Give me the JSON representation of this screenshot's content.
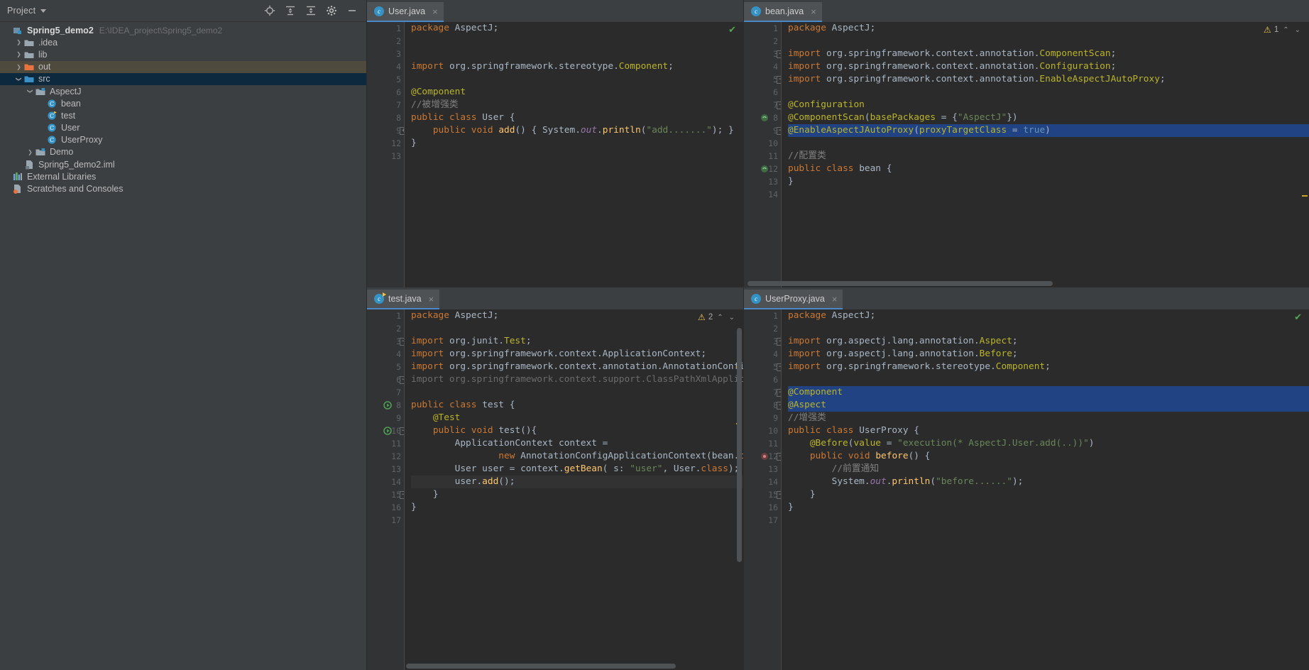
{
  "sidebar": {
    "title": "Project",
    "tools": [
      {
        "name": "locate-icon",
        "label": "Select Opened File"
      },
      {
        "name": "collapse-all-icon",
        "label": "Collapse All"
      },
      {
        "name": "expand-all-icon",
        "label": "Expand All"
      },
      {
        "name": "settings-gear-icon",
        "label": "Settings"
      },
      {
        "name": "hide-icon",
        "label": "Hide"
      }
    ],
    "tree": [
      {
        "label": "Spring5_demo2",
        "path": "E:\\IDEA_project\\Spring5_demo2",
        "icon": "module-icon",
        "indent": 0,
        "arrow": "",
        "bold": true,
        "state": "normal"
      },
      {
        "label": ".idea",
        "path": "",
        "icon": "folder-icon",
        "indent": 1,
        "arrow": "collapsed",
        "bold": false,
        "state": "normal"
      },
      {
        "label": "lib",
        "path": "",
        "icon": "folder-icon",
        "indent": 1,
        "arrow": "collapsed",
        "bold": false,
        "state": "normal"
      },
      {
        "label": "out",
        "path": "",
        "icon": "folder-orange-icon",
        "indent": 1,
        "arrow": "collapsed",
        "bold": false,
        "state": "out"
      },
      {
        "label": "src",
        "path": "",
        "icon": "folder-source-icon",
        "indent": 1,
        "arrow": "expanded",
        "bold": false,
        "state": "selected"
      },
      {
        "label": "AspectJ",
        "path": "",
        "icon": "package-icon",
        "indent": 2,
        "arrow": "expanded",
        "bold": false,
        "state": "normal"
      },
      {
        "label": "bean",
        "path": "",
        "icon": "java-class-icon",
        "indent": 3,
        "arrow": "",
        "bold": false,
        "state": "normal"
      },
      {
        "label": "test",
        "path": "",
        "icon": "java-test-class-icon",
        "indent": 3,
        "arrow": "",
        "bold": false,
        "state": "normal"
      },
      {
        "label": "User",
        "path": "",
        "icon": "java-class-icon",
        "indent": 3,
        "arrow": "",
        "bold": false,
        "state": "normal"
      },
      {
        "label": "UserProxy",
        "path": "",
        "icon": "java-class-icon",
        "indent": 3,
        "arrow": "",
        "bold": false,
        "state": "normal"
      },
      {
        "label": "Demo",
        "path": "",
        "icon": "package-icon",
        "indent": 2,
        "arrow": "collapsed",
        "bold": false,
        "state": "normal"
      },
      {
        "label": "Spring5_demo2.iml",
        "path": "",
        "icon": "iml-file-icon",
        "indent": 1,
        "arrow": "",
        "bold": false,
        "state": "normal"
      },
      {
        "label": "External Libraries",
        "path": "",
        "icon": "libraries-icon",
        "indent": 0,
        "arrow": "",
        "bold": false,
        "state": "normal"
      },
      {
        "label": "Scratches and Consoles",
        "path": "",
        "icon": "scratches-icon",
        "indent": 0,
        "arrow": "",
        "bold": false,
        "state": "normal"
      }
    ]
  },
  "panes": {
    "user": {
      "tab": {
        "label": "User.java",
        "icon": "java-class-icon",
        "close": "×"
      },
      "status": {
        "type": "ok",
        "icon": "check-icon",
        "count": ""
      },
      "lines": [
        {
          "n": "1",
          "mark": "",
          "fold": "",
          "sel": false
        },
        {
          "n": "2",
          "mark": "",
          "fold": "",
          "sel": false
        },
        {
          "n": "3",
          "mark": "",
          "fold": "",
          "sel": false
        },
        {
          "n": "4",
          "mark": "",
          "fold": "",
          "sel": false
        },
        {
          "n": "5",
          "mark": "",
          "fold": "",
          "sel": false
        },
        {
          "n": "6",
          "mark": "",
          "fold": "",
          "sel": false
        },
        {
          "n": "7",
          "mark": "",
          "fold": "",
          "sel": false
        },
        {
          "n": "8",
          "mark": "",
          "fold": "",
          "sel": false
        },
        {
          "n": "9",
          "mark": "",
          "fold": "plus",
          "sel": false
        },
        {
          "n": "12",
          "mark": "",
          "fold": "",
          "sel": false
        },
        {
          "n": "13",
          "mark": "",
          "fold": "",
          "sel": false
        }
      ],
      "code": [
        "package AspectJ;",
        "",
        "",
        "import org.springframework.stereotype.Component;",
        "",
        "@Component",
        "//被增强类",
        "public class User {",
        "    public void add() { System.out.println(\"add.......\"); }",
        "}",
        ""
      ]
    },
    "bean": {
      "tab": {
        "label": "bean.java",
        "icon": "java-class-icon",
        "close": "×"
      },
      "status": {
        "type": "warn",
        "icon": "warning-icon",
        "count": "1",
        "up": "⌃",
        "down": "⌄"
      },
      "lines": [
        {
          "n": "1",
          "mark": "",
          "fold": "",
          "sel": false
        },
        {
          "n": "2",
          "mark": "",
          "fold": "",
          "sel": false
        },
        {
          "n": "3",
          "mark": "",
          "fold": "minus",
          "sel": false
        },
        {
          "n": "4",
          "mark": "",
          "fold": "",
          "sel": false
        },
        {
          "n": "5",
          "mark": "",
          "fold": "minus",
          "sel": false
        },
        {
          "n": "6",
          "mark": "",
          "fold": "",
          "sel": false
        },
        {
          "n": "7",
          "mark": "",
          "fold": "minus",
          "sel": false
        },
        {
          "n": "8",
          "mark": "bean-gutter-icon",
          "fold": "",
          "sel": false
        },
        {
          "n": "9",
          "mark": "",
          "fold": "minus",
          "sel": true
        },
        {
          "n": "10",
          "mark": "",
          "fold": "",
          "sel": false
        },
        {
          "n": "11",
          "mark": "",
          "fold": "",
          "sel": false
        },
        {
          "n": "12",
          "mark": "bean-gutter-icon",
          "fold": "",
          "sel": false
        },
        {
          "n": "13",
          "mark": "",
          "fold": "",
          "sel": false
        },
        {
          "n": "14",
          "mark": "",
          "fold": "",
          "sel": false
        }
      ],
      "code": [
        "package AspectJ;",
        "",
        "import org.springframework.context.annotation.ComponentScan;",
        "import org.springframework.context.annotation.Configuration;",
        "import org.springframework.context.annotation.EnableAspectJAutoProxy;",
        "",
        "@Configuration",
        "@ComponentScan(basePackages = {\"AspectJ\"})",
        "@EnableAspectJAutoProxy(proxyTargetClass = true)",
        "",
        "//配置类",
        "public class bean {",
        "}",
        ""
      ]
    },
    "test": {
      "tab": {
        "label": "test.java",
        "icon": "java-test-class-icon",
        "close": "×"
      },
      "status": {
        "type": "warn",
        "icon": "warning-icon",
        "count": "2",
        "up": "⌃",
        "down": "⌄"
      },
      "lines": [
        {
          "n": "1",
          "mark": "",
          "fold": "",
          "sel": false
        },
        {
          "n": "2",
          "mark": "",
          "fold": "",
          "sel": false
        },
        {
          "n": "3",
          "mark": "",
          "fold": "minus",
          "sel": false
        },
        {
          "n": "4",
          "mark": "",
          "fold": "",
          "sel": false
        },
        {
          "n": "5",
          "mark": "",
          "fold": "",
          "sel": false
        },
        {
          "n": "6",
          "mark": "",
          "fold": "minus",
          "sel": false
        },
        {
          "n": "7",
          "mark": "",
          "fold": "",
          "sel": false
        },
        {
          "n": "8",
          "mark": "run-icon",
          "fold": "",
          "sel": false
        },
        {
          "n": "9",
          "mark": "",
          "fold": "",
          "sel": false
        },
        {
          "n": "10",
          "mark": "run-icon",
          "fold": "minus",
          "sel": false
        },
        {
          "n": "11",
          "mark": "",
          "fold": "",
          "sel": false
        },
        {
          "n": "12",
          "mark": "",
          "fold": "",
          "sel": false
        },
        {
          "n": "13",
          "mark": "",
          "fold": "",
          "sel": false
        },
        {
          "n": "14",
          "mark": "",
          "fold": "",
          "sel": false
        },
        {
          "n": "15",
          "mark": "",
          "fold": "minus",
          "sel": false
        },
        {
          "n": "16",
          "mark": "",
          "fold": "",
          "sel": false
        },
        {
          "n": "17",
          "mark": "",
          "fold": "",
          "sel": false
        }
      ],
      "code": [
        "package AspectJ;",
        "",
        "import org.junit.Test;",
        "import org.springframework.context.ApplicationContext;",
        "import org.springframework.context.annotation.AnnotationConfigApplicat",
        "import org.springframework.context.support.ClassPathXmlApplicationCon",
        "",
        "public class test {",
        "    @Test",
        "    public void test(){",
        "        ApplicationContext context =",
        "                new AnnotationConfigApplicationContext(bean.class);",
        "        User user = context.getBean( s: \"user\", User.class);",
        "        user.add();",
        "    }",
        "}",
        ""
      ]
    },
    "userproxy": {
      "tab": {
        "label": "UserProxy.java",
        "icon": "java-class-icon",
        "close": "×"
      },
      "status": {
        "type": "ok",
        "icon": "check-icon",
        "count": ""
      },
      "lines": [
        {
          "n": "1",
          "mark": "",
          "fold": "",
          "sel": false
        },
        {
          "n": "2",
          "mark": "",
          "fold": "",
          "sel": false
        },
        {
          "n": "3",
          "mark": "",
          "fold": "minus",
          "sel": false
        },
        {
          "n": "4",
          "mark": "",
          "fold": "",
          "sel": false
        },
        {
          "n": "5",
          "mark": "",
          "fold": "minus",
          "sel": false
        },
        {
          "n": "6",
          "mark": "",
          "fold": "",
          "sel": false
        },
        {
          "n": "7",
          "mark": "",
          "fold": "minus",
          "sel": true
        },
        {
          "n": "8",
          "mark": "",
          "fold": "minus",
          "sel": true
        },
        {
          "n": "9",
          "mark": "",
          "fold": "",
          "sel": false
        },
        {
          "n": "10",
          "mark": "",
          "fold": "",
          "sel": false
        },
        {
          "n": "11",
          "mark": "",
          "fold": "",
          "sel": false
        },
        {
          "n": "12",
          "mark": "aspect-gutter-icon",
          "fold": "minus",
          "sel": false
        },
        {
          "n": "13",
          "mark": "",
          "fold": "",
          "sel": false
        },
        {
          "n": "14",
          "mark": "",
          "fold": "",
          "sel": false
        },
        {
          "n": "15",
          "mark": "",
          "fold": "minus",
          "sel": false
        },
        {
          "n": "16",
          "mark": "",
          "fold": "",
          "sel": false
        },
        {
          "n": "17",
          "mark": "",
          "fold": "",
          "sel": false
        }
      ],
      "code": [
        "package AspectJ;",
        "",
        "import org.aspectj.lang.annotation.Aspect;",
        "import org.aspectj.lang.annotation.Before;",
        "import org.springframework.stereotype.Component;",
        "",
        "@Component",
        "@Aspect",
        "//增强类",
        "public class UserProxy {",
        "    @Before(value = \"execution(* AspectJ.User.add(..))\")",
        "    public void before() {",
        "        //前置通知",
        "        System.out.println(\"before......\");",
        "    }",
        "}",
        ""
      ]
    }
  },
  "colors": {
    "accent": "#4a88c7",
    "selection": "#214283",
    "keyword": "#cc7832",
    "string": "#6a8759",
    "annotation": "#bbb529",
    "comment": "#808080",
    "number": "#6897bb",
    "field": "#9876aa",
    "method": "#ffc66d",
    "editor_bg": "#2b2b2b",
    "panel_bg": "#3c3f41",
    "gutter_bg": "#313335",
    "warning": "#f2c55c",
    "ok": "#53a653"
  }
}
